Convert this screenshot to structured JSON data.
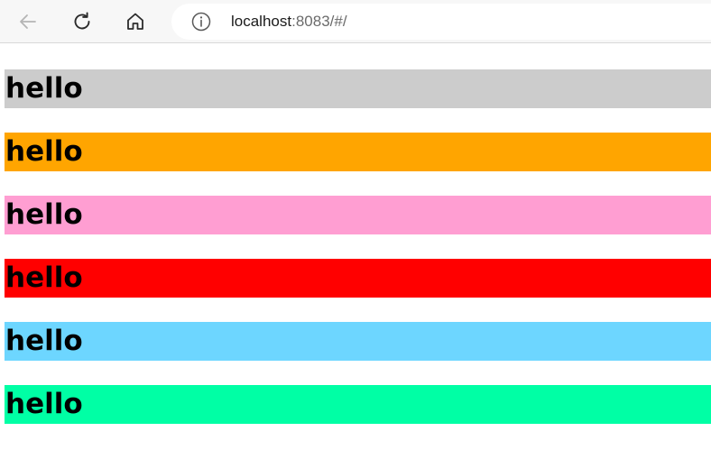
{
  "browser": {
    "address_bar": {
      "host": "localhost",
      "rest": ":8083/#/"
    },
    "icons": {
      "back": "back-arrow-icon",
      "reload": "reload-icon",
      "home": "home-icon",
      "site_info": "info-icon"
    }
  },
  "page": {
    "rows": [
      {
        "text": "hello",
        "color": "#cccccc"
      },
      {
        "text": "hello",
        "color": "#ffa500"
      },
      {
        "text": "hello",
        "color": "#ff9ed2"
      },
      {
        "text": "hello",
        "color": "#ff0000"
      },
      {
        "text": "hello",
        "color": "#6dd6ff"
      },
      {
        "text": "hello",
        "color": "#00ffa5"
      }
    ]
  }
}
